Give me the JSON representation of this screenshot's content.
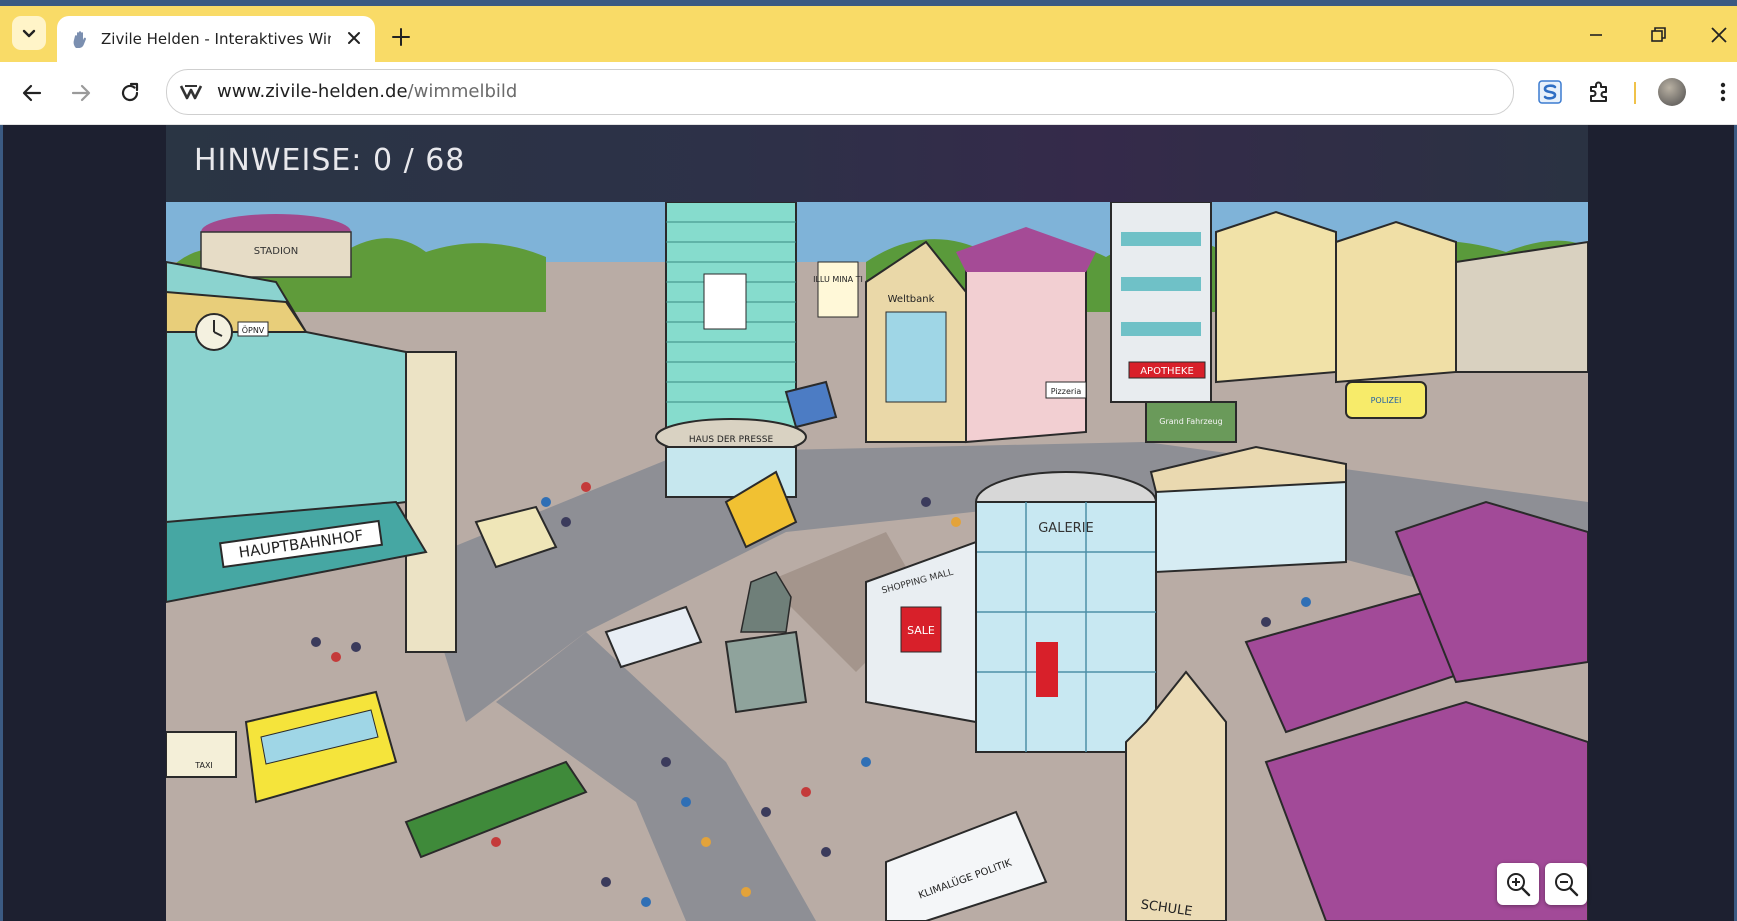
{
  "browser": {
    "tab": {
      "title": "Zivile Helden - Interaktives Wimmelbild"
    },
    "address": {
      "host": "www.zivile-helden.de",
      "path": "/wimmelbild"
    }
  },
  "page": {
    "hints": {
      "label": "HINWEISE:",
      "found": 0,
      "total": 68,
      "display": "HINWEISE: 0 / 68"
    },
    "signs": {
      "stadion": "STADION",
      "oepnv": "ÖPNV",
      "hauptbahnhof": "HAUPTBAHNHOF",
      "haus_der_presse": "HAUS DER PRESSE",
      "weltbank": "Weltbank",
      "apotheke": "APOTHEKE",
      "pizzeria": "Pizzeria",
      "galerie": "GALERIE",
      "shopping_mall": "SHOPPING MALL",
      "sale": "SALE",
      "polizei": "POLIZEI",
      "schule": "SCHULE",
      "klimaluege": "KLIMALÜGE POLITIK",
      "taxi": "TAXI",
      "grandfahrzeug": "Grand Fahrzeug",
      "illuminati": "ILLU MINA TI"
    }
  }
}
